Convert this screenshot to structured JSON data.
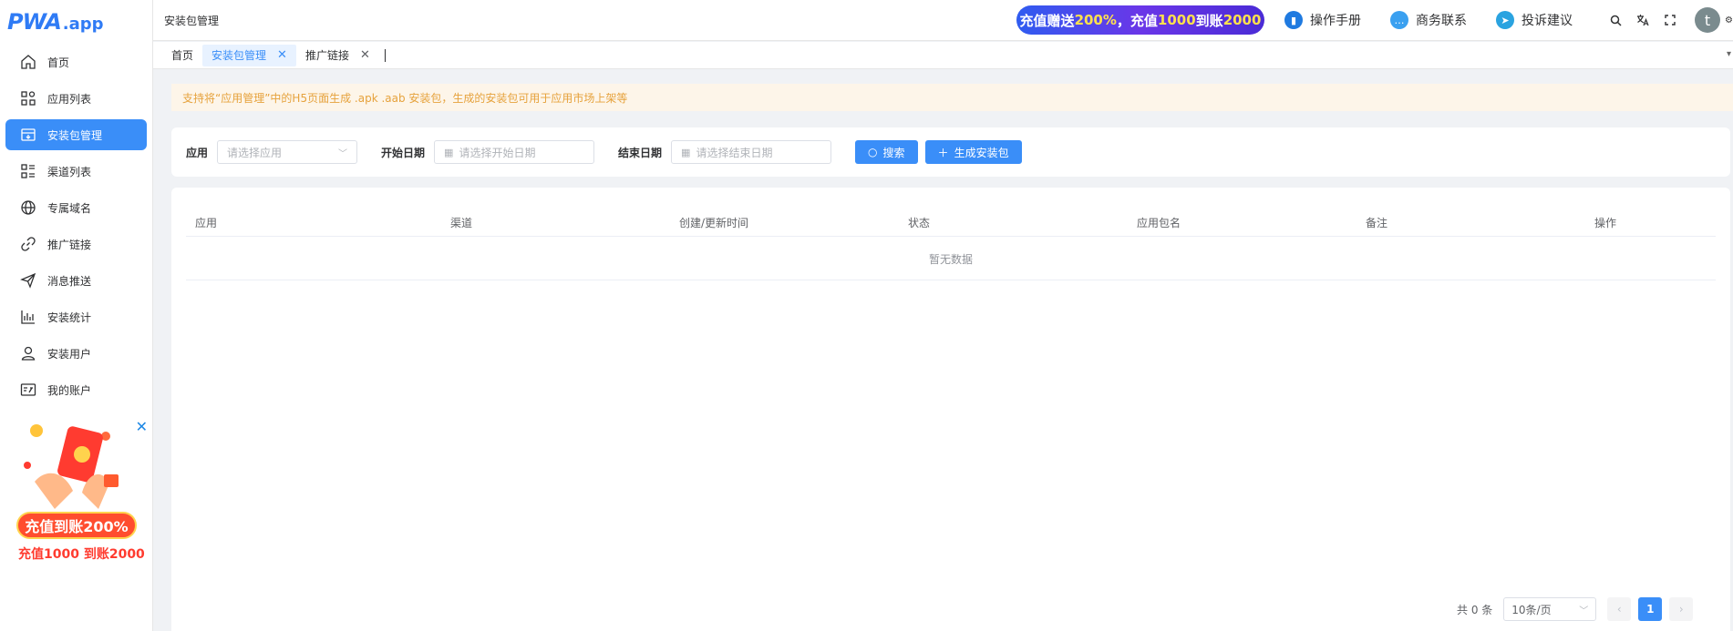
{
  "logo": {
    "mark": "PWA",
    "domain": ".app"
  },
  "sidebar": {
    "items": [
      {
        "label": "首页",
        "icon": "home-icon"
      },
      {
        "label": "应用列表",
        "icon": "apps-icon"
      },
      {
        "label": "安装包管理",
        "icon": "package-icon",
        "active": true
      },
      {
        "label": "渠道列表",
        "icon": "channel-list-icon"
      },
      {
        "label": "专属域名",
        "icon": "globe-icon"
      },
      {
        "label": "推广链接",
        "icon": "link-icon"
      },
      {
        "label": "消息推送",
        "icon": "send-icon"
      },
      {
        "label": "安装统计",
        "icon": "stats-icon"
      },
      {
        "label": "安装用户",
        "icon": "user-icon"
      },
      {
        "label": "我的账户",
        "icon": "account-icon"
      }
    ],
    "promo": {
      "main": "充值到账200%",
      "sub": "充值1000 到账2000",
      "close": "✕"
    }
  },
  "header": {
    "breadcrumb": "安装包管理",
    "banner": {
      "part1": "充值赠送",
      "hl1": "200%",
      "part2": "，充值",
      "hl2": "1000",
      "part3": "到账",
      "hl3": "2000"
    },
    "links": [
      {
        "label": "操作手册",
        "icon": "book-icon"
      },
      {
        "label": "商务联系",
        "icon": "chat-icon"
      },
      {
        "label": "投诉建议",
        "icon": "telegram-icon"
      }
    ],
    "avatar_letter": "t"
  },
  "tabs": [
    {
      "label": "首页",
      "closable": false
    },
    {
      "label": "安装包管理",
      "closable": true,
      "active": true
    },
    {
      "label": "推广链接",
      "closable": true
    }
  ],
  "notice": "支持将“应用管理”中的H5页面生成 .apk .aab 安装包，生成的安装包可用于应用市场上架等",
  "filters": {
    "app_label": "应用",
    "app_placeholder": "请选择应用",
    "start_label": "开始日期",
    "start_placeholder": "请选择开始日期",
    "end_label": "结束日期",
    "end_placeholder": "请选择结束日期",
    "search_button": "搜索",
    "generate_button": "生成安装包"
  },
  "table": {
    "columns": [
      "应用",
      "渠道",
      "创建/更新时间",
      "状态",
      "应用包名",
      "备注",
      "操作"
    ],
    "empty_text": "暂无数据"
  },
  "pagination": {
    "total": "共 0 条",
    "page_size": "10条/页",
    "current_page": "1"
  },
  "colors": {
    "primary": "#3a8ef8",
    "notice_text": "#e6a23c",
    "notice_bg": "#fdf5e9"
  }
}
